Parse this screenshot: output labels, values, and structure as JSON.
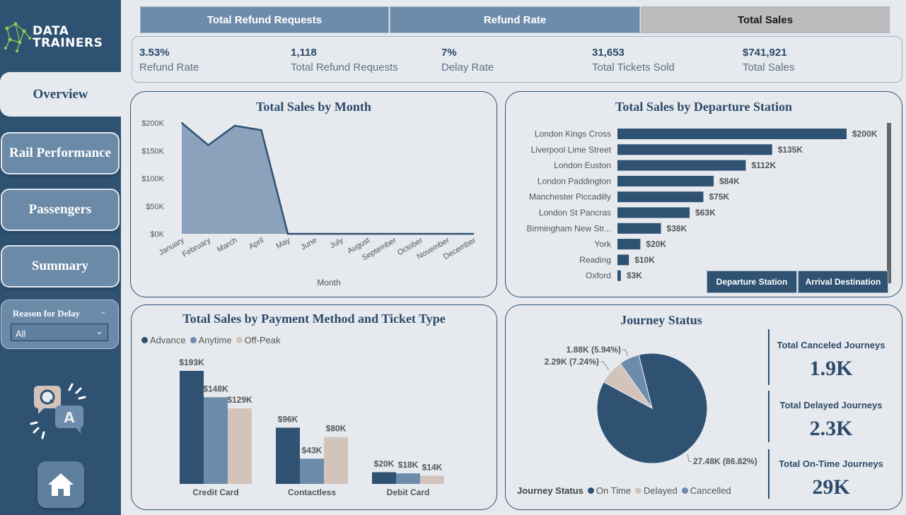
{
  "brand": {
    "line1": "DATA",
    "line2": "TRAINERS"
  },
  "nav": {
    "overview": "Overview",
    "rail_performance": "Rail Performance",
    "passengers": "Passengers",
    "summary": "Summary"
  },
  "slicer": {
    "title": "Reason for Delay",
    "value": "All"
  },
  "tabs": [
    "Total Refund Requests",
    "Refund Rate",
    "Total Sales"
  ],
  "kpis": [
    {
      "value": "3.53%",
      "label": "Refund Rate"
    },
    {
      "value": "1,118",
      "label": "Total Refund Requests"
    },
    {
      "value": "7%",
      "label": "Delay Rate"
    },
    {
      "value": "31,653",
      "label": "Total Tickets Sold"
    },
    {
      "value": "$741,921",
      "label": "Total Sales"
    }
  ],
  "colors": {
    "navy": "#2f5272",
    "steel": "#6d8cab",
    "sand": "#d3c4bb",
    "area": "#8ca2bc"
  },
  "chart_data": [
    {
      "type": "area",
      "title": "Total Sales by Month",
      "xlabel": "Month",
      "categories": [
        "January",
        "February",
        "March",
        "April",
        "May",
        "June",
        "July",
        "August",
        "September",
        "October",
        "November",
        "December"
      ],
      "values": [
        200000,
        160000,
        195000,
        187000,
        0,
        0,
        0,
        0,
        0,
        0,
        0,
        0
      ],
      "yticks": [
        "$0K",
        "$50K",
        "$100K",
        "$150K",
        "$200K"
      ],
      "ylim": [
        0,
        200000
      ]
    },
    {
      "type": "bar",
      "orientation": "horizontal",
      "title": "Total Sales by Departure Station",
      "categories": [
        "London Kings Cross",
        "Liverpool Lime Street",
        "London Euston",
        "London Paddington",
        "Manchester Piccadilly",
        "London St Pancras",
        "Birmingham New Str...",
        "York",
        "Reading",
        "Oxford"
      ],
      "values": [
        200000,
        135000,
        112000,
        84000,
        75000,
        63000,
        38000,
        20000,
        10000,
        3000
      ],
      "labels": [
        "$200K",
        "$135K",
        "$112K",
        "$84K",
        "$75K",
        "$63K",
        "$38K",
        "$20K",
        "$10K",
        "$3K"
      ],
      "buttons": [
        "Departure Station",
        "Arrival Destination"
      ]
    },
    {
      "type": "bar",
      "title": "Total Sales by Payment Method and Ticket Type",
      "categories": [
        "Credit Card",
        "Contactless",
        "Debit Card"
      ],
      "series": [
        {
          "name": "Advance",
          "values": [
            193000,
            96000,
            20000
          ],
          "labels": [
            "$193K",
            "$96K",
            "$20K"
          ]
        },
        {
          "name": "Anytime",
          "values": [
            148000,
            43000,
            18000
          ],
          "labels": [
            "$148K",
            "$43K",
            "$18K"
          ]
        },
        {
          "name": "Off-Peak",
          "values": [
            129000,
            80000,
            14000
          ],
          "labels": [
            "$129K",
            "$80K",
            "$14K"
          ]
        }
      ]
    },
    {
      "type": "pie",
      "title": "Journey Status",
      "legend_title": "Journey Status",
      "slices": [
        {
          "name": "On Time",
          "value": 27480,
          "label": "27.48K (86.82%)"
        },
        {
          "name": "Delayed",
          "value": 2290,
          "label": "2.29K (7.24%)"
        },
        {
          "name": "Cancelled",
          "value": 1880,
          "label": "1.88K (5.94%)"
        }
      ]
    }
  ],
  "journey_kpis": [
    {
      "title": "Total Canceled Journeys",
      "value": "1.9K"
    },
    {
      "title": "Total Delayed Journeys",
      "value": "2.3K"
    },
    {
      "title": "Total On-Time Journeys",
      "value": "29K"
    }
  ]
}
